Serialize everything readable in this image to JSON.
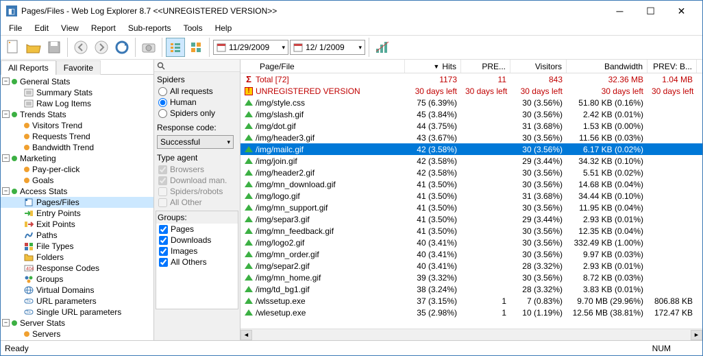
{
  "window": {
    "title": "Pages/Files - Web Log Explorer 8.7 <<UNREGISTERED VERSION>>"
  },
  "menu": [
    "File",
    "Edit",
    "View",
    "Report",
    "Sub-reports",
    "Tools",
    "Help"
  ],
  "dates": {
    "from": "11/29/2009",
    "to": "12/  1/2009"
  },
  "tabs": {
    "active": "All Reports",
    "other": "Favorite"
  },
  "tree": [
    {
      "type": "group",
      "label": "General Stats",
      "dot": "green"
    },
    {
      "type": "item",
      "label": "Summary Stats",
      "icon": "doc"
    },
    {
      "type": "item",
      "label": "Raw Log Items",
      "icon": "doc"
    },
    {
      "type": "group",
      "label": "Trends Stats",
      "dot": "green"
    },
    {
      "type": "item",
      "label": "Visitors Trend",
      "dot": "orange"
    },
    {
      "type": "item",
      "label": "Requests Trend",
      "dot": "orange"
    },
    {
      "type": "item",
      "label": "Bandwidth Trend",
      "dot": "orange"
    },
    {
      "type": "group",
      "label": "Marketing",
      "dot": "green"
    },
    {
      "type": "item",
      "label": "Pay-per-click",
      "dot": "orange"
    },
    {
      "type": "item",
      "label": "Goals",
      "dot": "orange"
    },
    {
      "type": "group",
      "label": "Access Stats",
      "dot": "green"
    },
    {
      "type": "item",
      "label": "Pages/Files",
      "icon": "file",
      "sel": true
    },
    {
      "type": "item",
      "label": "Entry Points",
      "icon": "entry"
    },
    {
      "type": "item",
      "label": "Exit Points",
      "icon": "exit"
    },
    {
      "type": "item",
      "label": "Paths",
      "icon": "path"
    },
    {
      "type": "item",
      "label": "File Types",
      "icon": "ft"
    },
    {
      "type": "item",
      "label": "Folders",
      "icon": "folder"
    },
    {
      "type": "item",
      "label": "Response Codes",
      "icon": "rc"
    },
    {
      "type": "item",
      "label": "Groups",
      "icon": "grp"
    },
    {
      "type": "item",
      "label": "Virtual Domains",
      "icon": "vd"
    },
    {
      "type": "item",
      "label": "URL parameters",
      "icon": "url"
    },
    {
      "type": "item",
      "label": "Single URL parameters",
      "icon": "url"
    },
    {
      "type": "group",
      "label": "Server Stats",
      "dot": "green"
    },
    {
      "type": "item",
      "label": "Servers",
      "dot": "orange"
    }
  ],
  "filters": {
    "spiders_label": "Spiders",
    "spiders_options": [
      "All requests",
      "Human",
      "Spiders only"
    ],
    "spiders_selected": "Human",
    "response_label": "Response code:",
    "response_value": "Successful",
    "typeagent_label": "Type agent",
    "typeagent_options": [
      "Browsers",
      "Download man.",
      "Spiders/robots",
      "All Other"
    ],
    "groups_label": "Groups:",
    "groups_options": [
      "Pages",
      "Downloads",
      "Images",
      "All Others"
    ]
  },
  "columns": [
    "Page/File",
    "Hits",
    "PRE...",
    "Visitors",
    "Bandwidth",
    "PREV: B..."
  ],
  "rows": [
    {
      "kind": "total",
      "label": "Total [72]",
      "hits": "1173",
      "pre": "11",
      "vis": "843",
      "bw": "32.36 MB",
      "pb": "1.04 MB"
    },
    {
      "kind": "unreg",
      "label": "UNREGISTERED VERSION",
      "hits": "30 days left",
      "pre": "30 days left",
      "vis": "30 days left",
      "bw": "30 days left",
      "pb": "30 days left"
    },
    {
      "kind": "data",
      "label": "/img/style.css",
      "hits": "75 (6.39%)",
      "pre": "",
      "vis": "30 (3.56%)",
      "bw": "51.80 KB (0.16%)",
      "pb": ""
    },
    {
      "kind": "data",
      "label": "/img/slash.gif",
      "hits": "45 (3.84%)",
      "pre": "",
      "vis": "30 (3.56%)",
      "bw": "2.42 KB (0.01%)",
      "pb": ""
    },
    {
      "kind": "data",
      "label": "/img/dot.gif",
      "hits": "44 (3.75%)",
      "pre": "",
      "vis": "31 (3.68%)",
      "bw": "1.53 KB (0.00%)",
      "pb": ""
    },
    {
      "kind": "data",
      "label": "/img/header3.gif",
      "hits": "43 (3.67%)",
      "pre": "",
      "vis": "30 (3.56%)",
      "bw": "11.56 KB (0.03%)",
      "pb": ""
    },
    {
      "kind": "sel",
      "label": "/img/mailc.gif",
      "hits": "42 (3.58%)",
      "pre": "",
      "vis": "30 (3.56%)",
      "bw": "6.17 KB (0.02%)",
      "pb": ""
    },
    {
      "kind": "data",
      "label": "/img/join.gif",
      "hits": "42 (3.58%)",
      "pre": "",
      "vis": "29 (3.44%)",
      "bw": "34.32 KB (0.10%)",
      "pb": ""
    },
    {
      "kind": "data",
      "label": "/img/header2.gif",
      "hits": "42 (3.58%)",
      "pre": "",
      "vis": "30 (3.56%)",
      "bw": "5.51 KB (0.02%)",
      "pb": ""
    },
    {
      "kind": "data",
      "label": "/img/mn_download.gif",
      "hits": "41 (3.50%)",
      "pre": "",
      "vis": "30 (3.56%)",
      "bw": "14.68 KB (0.04%)",
      "pb": ""
    },
    {
      "kind": "data",
      "label": "/img/logo.gif",
      "hits": "41 (3.50%)",
      "pre": "",
      "vis": "31 (3.68%)",
      "bw": "34.44 KB (0.10%)",
      "pb": ""
    },
    {
      "kind": "data",
      "label": "/img/mn_support.gif",
      "hits": "41 (3.50%)",
      "pre": "",
      "vis": "30 (3.56%)",
      "bw": "11.95 KB (0.04%)",
      "pb": ""
    },
    {
      "kind": "data",
      "label": "/img/separ3.gif",
      "hits": "41 (3.50%)",
      "pre": "",
      "vis": "29 (3.44%)",
      "bw": "2.93 KB (0.01%)",
      "pb": ""
    },
    {
      "kind": "data",
      "label": "/img/mn_feedback.gif",
      "hits": "41 (3.50%)",
      "pre": "",
      "vis": "30 (3.56%)",
      "bw": "12.35 KB (0.04%)",
      "pb": ""
    },
    {
      "kind": "data",
      "label": "/img/logo2.gif",
      "hits": "40 (3.41%)",
      "pre": "",
      "vis": "30 (3.56%)",
      "bw": "332.49 KB (1.00%)",
      "pb": ""
    },
    {
      "kind": "data",
      "label": "/img/mn_order.gif",
      "hits": "40 (3.41%)",
      "pre": "",
      "vis": "30 (3.56%)",
      "bw": "9.97 KB (0.03%)",
      "pb": ""
    },
    {
      "kind": "data",
      "label": "/img/separ2.gif",
      "hits": "40 (3.41%)",
      "pre": "",
      "vis": "28 (3.32%)",
      "bw": "2.93 KB (0.01%)",
      "pb": ""
    },
    {
      "kind": "data",
      "label": "/img/mn_home.gif",
      "hits": "39 (3.32%)",
      "pre": "",
      "vis": "30 (3.56%)",
      "bw": "8.72 KB (0.03%)",
      "pb": ""
    },
    {
      "kind": "data",
      "label": "/img/td_bg1.gif",
      "hits": "38 (3.24%)",
      "pre": "",
      "vis": "28 (3.32%)",
      "bw": "3.83 KB (0.01%)",
      "pb": ""
    },
    {
      "kind": "data",
      "label": "/wlssetup.exe",
      "hits": "37 (3.15%)",
      "pre": "1",
      "vis": "7 (0.83%)",
      "bw": "9.70 MB (29.96%)",
      "pb": "806.88 KB"
    },
    {
      "kind": "data",
      "label": "/wlesetup.exe",
      "hits": "35 (2.98%)",
      "pre": "1",
      "vis": "10 (1.19%)",
      "bw": "12.56 MB (38.81%)",
      "pb": "172.47 KB"
    }
  ],
  "status": {
    "left": "Ready",
    "right": "NUM"
  }
}
